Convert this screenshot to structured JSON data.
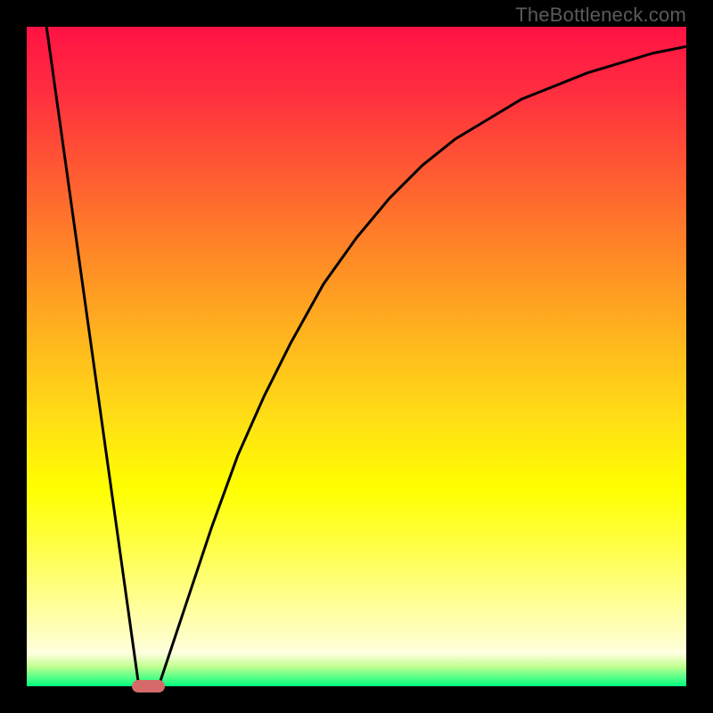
{
  "watermark": "TheBottleneck.com",
  "domain": "Chart",
  "chart_data": {
    "type": "line",
    "title": "",
    "xlabel": "",
    "ylabel": "",
    "xlim": [
      0,
      100
    ],
    "ylim": [
      0,
      100
    ],
    "grid": false,
    "legend": false,
    "note": "values are approximate, read visually from the plot (0 = bottom/left, 100 = top/right)",
    "series": [
      {
        "name": "left-descending-line",
        "x": [
          3,
          17
        ],
        "values": [
          100,
          0
        ]
      },
      {
        "name": "right-rising-curve",
        "x": [
          20,
          24,
          28,
          32,
          36,
          40,
          45,
          50,
          55,
          60,
          65,
          70,
          75,
          80,
          85,
          90,
          95,
          100
        ],
        "values": [
          0,
          12,
          24,
          35,
          44,
          52,
          61,
          68,
          74,
          79,
          83,
          86,
          89,
          91,
          93,
          94.5,
          96,
          97
        ]
      }
    ],
    "marker": {
      "name": "vertex-marker",
      "x_range": [
        16,
        21
      ],
      "y": 0,
      "color": "#d66a6a"
    },
    "background_gradient": {
      "orientation": "vertical",
      "stops": [
        {
          "pos": 0.0,
          "color": "#ff1244"
        },
        {
          "pos": 0.6,
          "color": "#ffe015"
        },
        {
          "pos": 0.8,
          "color": "#ffff40"
        },
        {
          "pos": 0.97,
          "color": "#c0ff90"
        },
        {
          "pos": 1.0,
          "color": "#00ff7f"
        }
      ]
    }
  }
}
